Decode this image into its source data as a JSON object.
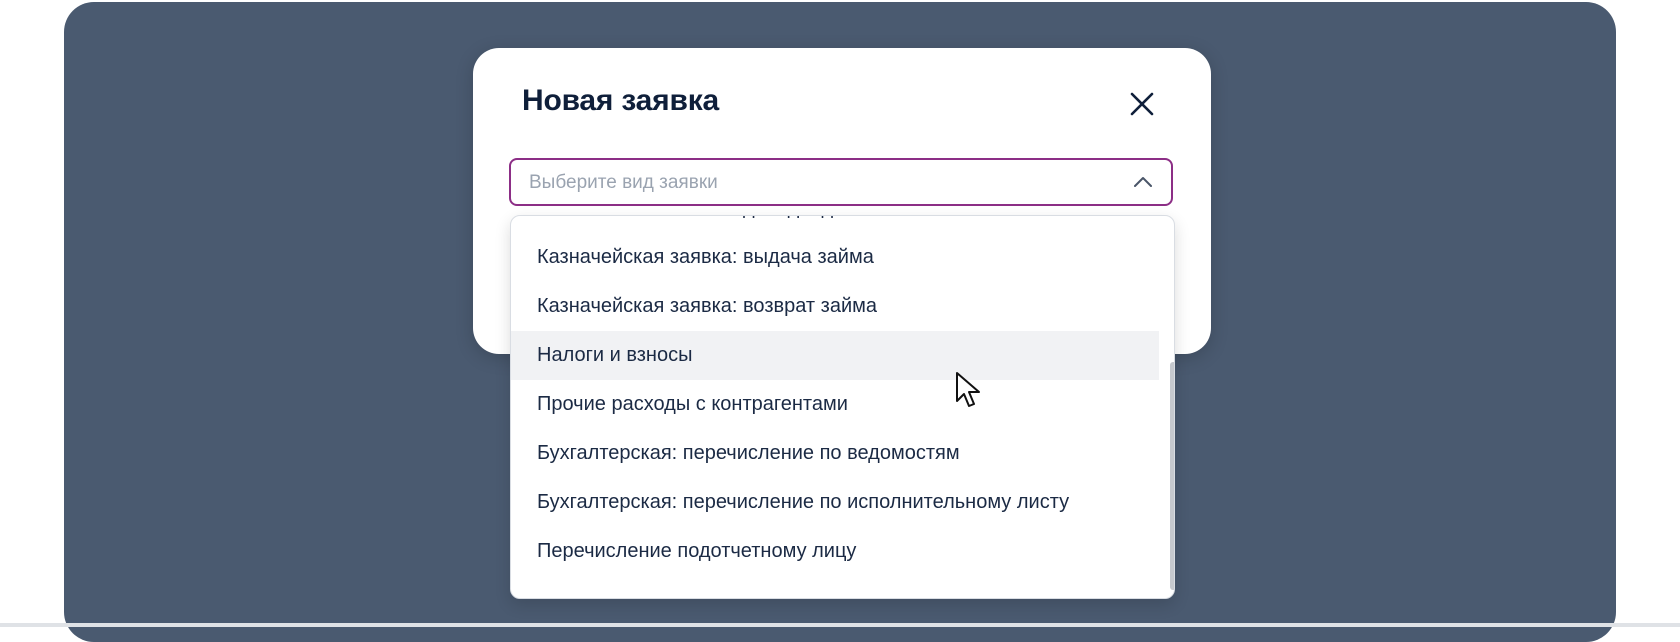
{
  "modal": {
    "title": "Новая заявка"
  },
  "select": {
    "placeholder": "Выберите вид заявки",
    "expanded": true
  },
  "dropdown": {
    "options": [
      "Казначейская заявка: дивиденды",
      "Казначейская заявка: выдача займа",
      "Казначейская заявка: возврат займа",
      "Налоги и взносы",
      "Прочие расходы с контрагентами",
      "Бухгалтерская: перечисление по ведомостям",
      "Бухгалтерская: перечисление по исполнительному листу",
      "Перечисление подотчетному лицу"
    ],
    "hovered_option": "Налоги и взносы"
  },
  "icons": {
    "close": "close-icon",
    "chevron": "chevron-up-icon",
    "cursor": "mouse-pointer-icon"
  },
  "colors": {
    "backdrop": "#4a5a70",
    "select_border": "#8c2e86",
    "title_text": "#0f1f3a",
    "option_text": "#1b2a44",
    "hover_bg": "#f1f2f4"
  }
}
